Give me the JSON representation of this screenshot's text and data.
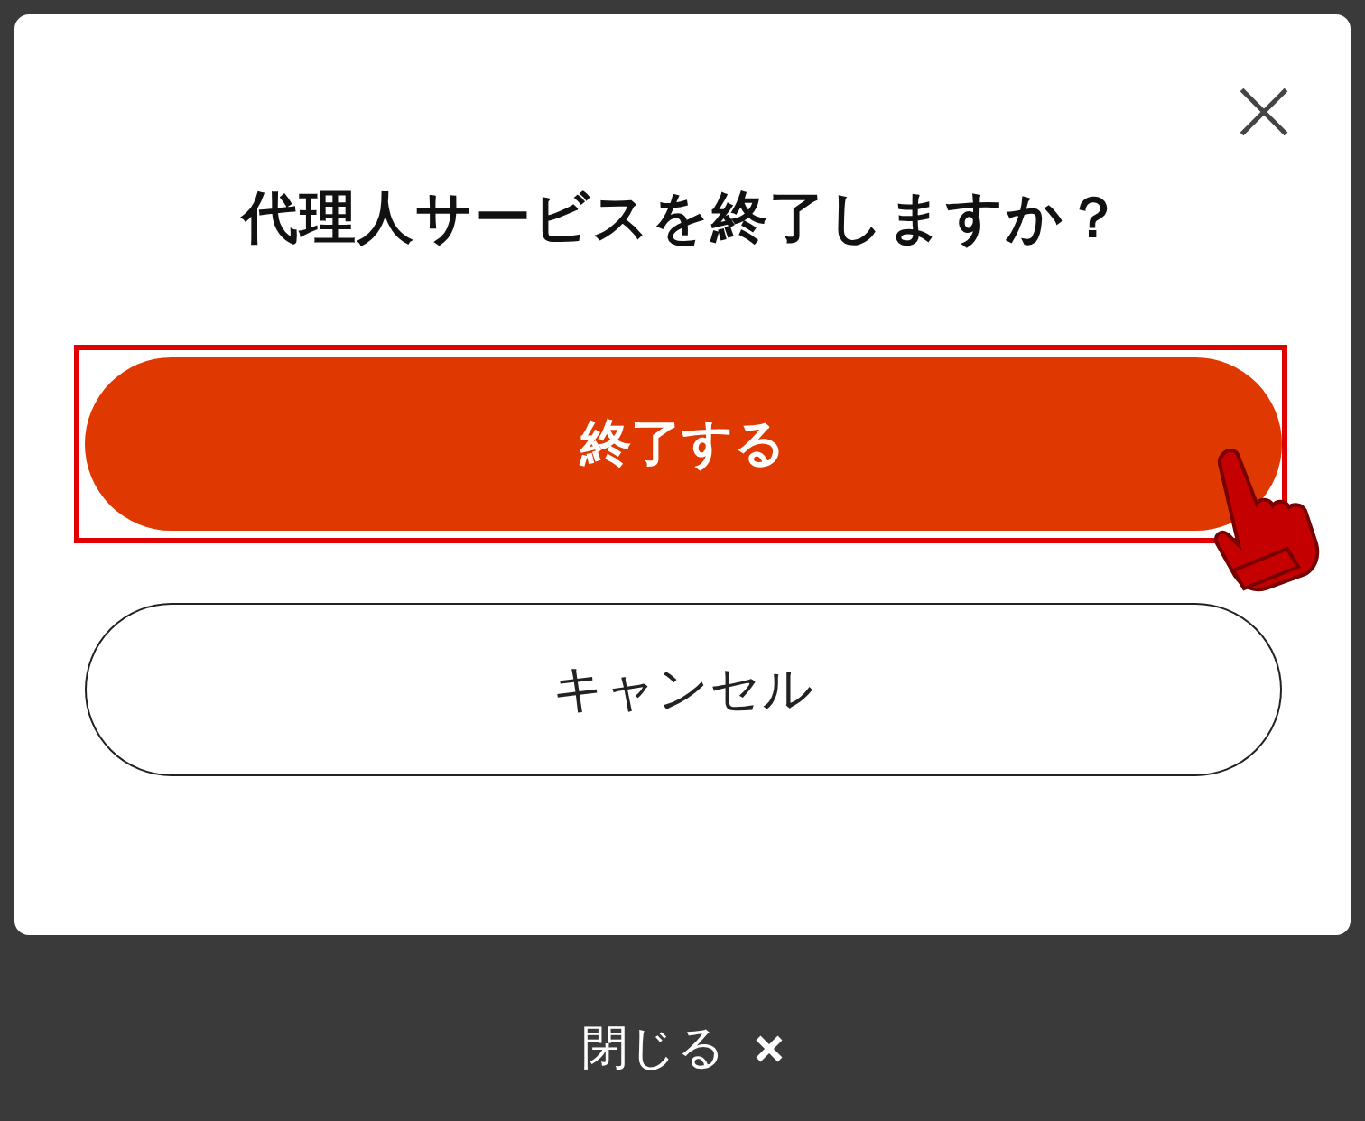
{
  "dialog": {
    "title": "代理人サービスを終了しますか？",
    "buttons": [
      {
        "label": "終了する",
        "kind": "primary",
        "highlighted": true
      },
      {
        "label": "キャンセル",
        "kind": "secondary",
        "highlighted": false
      }
    ]
  },
  "footer": {
    "close_label": "閉じる"
  }
}
